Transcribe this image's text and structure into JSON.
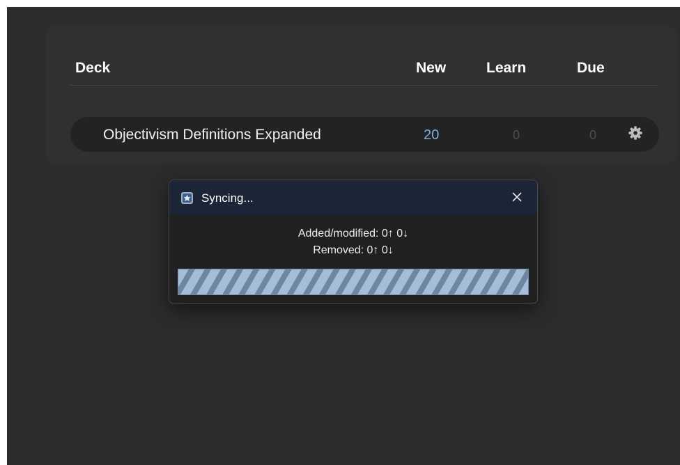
{
  "deck_list": {
    "columns": {
      "deck": "Deck",
      "new": "New",
      "learn": "Learn",
      "due": "Due"
    },
    "rows": [
      {
        "name": "Objectivism Definitions Expanded",
        "new": "20",
        "learn": "0",
        "due": "0",
        "icon": "gear-icon"
      }
    ]
  },
  "sync_dialog": {
    "title": "Syncing...",
    "added_line": "Added/modified: 0↑ 0↓",
    "removed_line": "Removed: 0↑ 0↓",
    "progress": "indeterminate"
  },
  "colors": {
    "background": "#2c2c2c",
    "panel": "#303030",
    "row": "#232323",
    "new_count": "#7eaed6",
    "zero_count": "#4d4d4d",
    "dialog_titlebar": "#1c2438",
    "progress_stripe_light": "#a5bdd8",
    "progress_stripe_dark": "#6f86a2"
  }
}
